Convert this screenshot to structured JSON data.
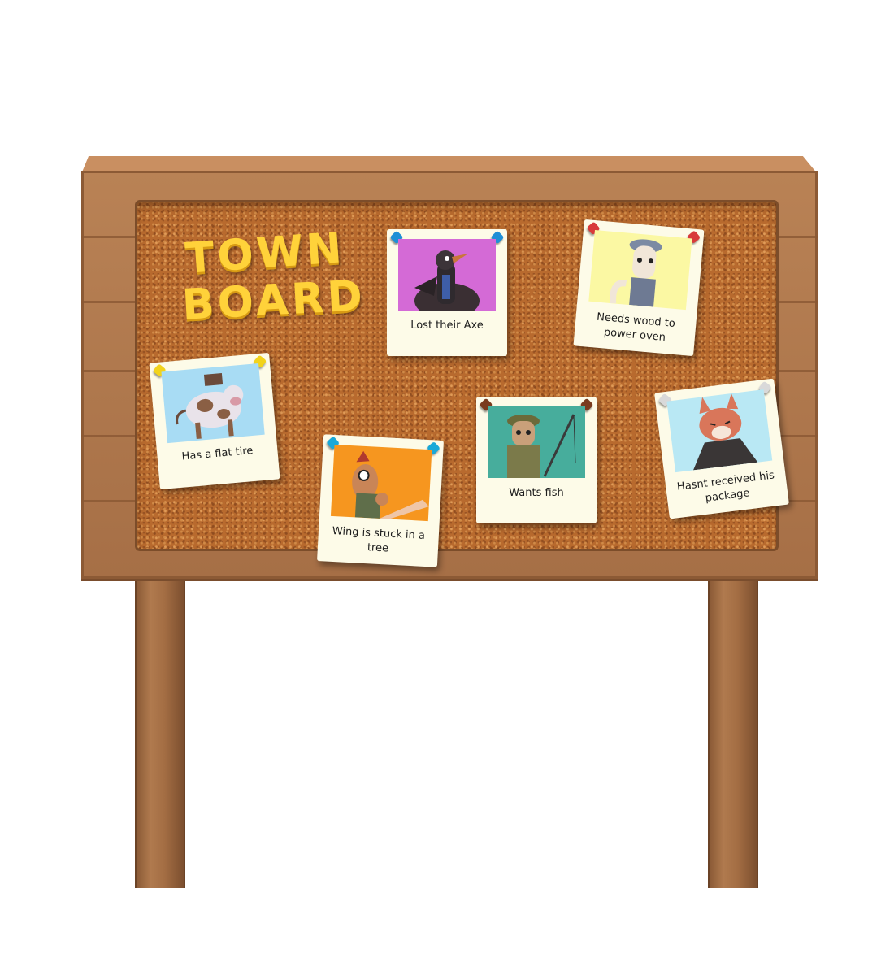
{
  "board": {
    "title_line1": "TOWN",
    "title_line2": "BOARD"
  },
  "notes": [
    {
      "id": "axe",
      "label": "Lost their Axe",
      "photo_bg": "#d46ad6",
      "pin_color": "#1f8fd6",
      "character_icon": "crow-icon"
    },
    {
      "id": "oven",
      "label": "Needs wood to power oven",
      "photo_bg": "#fbf8a3",
      "pin_color": "#d83a3a",
      "character_icon": "ferret-chef-icon"
    },
    {
      "id": "tire",
      "label": "Has a flat tire",
      "photo_bg": "#a8dcf4",
      "pin_color": "#f2d31b",
      "character_icon": "cow-icon"
    },
    {
      "id": "tree",
      "label": "Wing is stuck in a tree",
      "photo_bg": "#f6961f",
      "pin_color": "#1aa9d8",
      "character_icon": "chicken-icon"
    },
    {
      "id": "fish",
      "label": "Wants fish",
      "photo_bg": "#47ad9c",
      "pin_color": "#7a3b1d",
      "character_icon": "cat-fisher-icon"
    },
    {
      "id": "package",
      "label": "Hasnt received his package",
      "photo_bg": "#b9e8f4",
      "pin_color": "#d9d9d9",
      "character_icon": "fox-icon"
    }
  ]
}
